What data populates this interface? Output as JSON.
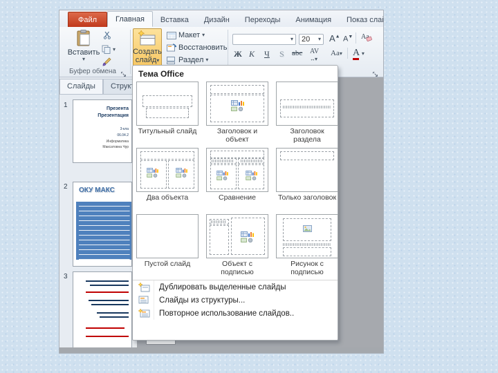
{
  "icons": {
    "dropdown_arrow": "▾"
  },
  "ribbon": {
    "tabs": [
      {
        "label": "Файл"
      },
      {
        "label": "Главная"
      },
      {
        "label": "Вставка"
      },
      {
        "label": "Дизайн"
      },
      {
        "label": "Переходы"
      },
      {
        "label": "Анимация"
      },
      {
        "label": "Показ слайдов"
      }
    ],
    "clipboard_group": {
      "paste": "Вставить",
      "label": "Буфер обмена"
    },
    "slides_group": {
      "new_slide_line1": "Создать",
      "new_slide_line2": "слайд",
      "layout": "Макет",
      "reset": "Восстановить",
      "section": "Раздел"
    },
    "font_group": {
      "font_size": "20",
      "bold": "Ж",
      "italic": "К",
      "underline": "Ч",
      "shadow": "S",
      "strike": "abc",
      "spacing": "AV",
      "case": "Aa",
      "color": "A",
      "grow": "A",
      "shrink": "A"
    }
  },
  "slides_panel": {
    "tab_slides": "Слайды",
    "tab_outline": "Структура",
    "slides": [
      {
        "number": "1",
        "title_line1": "Презента",
        "title_line2": "Презентация",
        "meta": [
          "3-кла",
          "06.04.2",
          "Информатика",
          "Максатовна Чур"
        ]
      },
      {
        "number": "2",
        "title": "ОКУ МАКС"
      },
      {
        "number": "3"
      }
    ]
  },
  "dropdown": {
    "header": "Тема Office",
    "layouts": [
      {
        "label": "Титульный слайд"
      },
      {
        "label": "Заголовок и объект"
      },
      {
        "label": "Заголовок раздела"
      },
      {
        "label": "Два объекта"
      },
      {
        "label": "Сравнение"
      },
      {
        "label": "Только заголовок"
      },
      {
        "label": "Пустой слайд"
      },
      {
        "label": "Объект с подписью"
      },
      {
        "label": "Рисунок с подписью"
      }
    ],
    "menu_items": [
      {
        "label": "Дублировать выделенные слайды"
      },
      {
        "label": "Слайды из структуры..."
      },
      {
        "label": "Повторное использование слайдов.."
      }
    ]
  },
  "colors": {
    "file_tab": "#c0391c",
    "new_slide_highlight": "#f6c35a",
    "slide_title_blue": "#17375e",
    "content_box_blue": "#4f81bd"
  }
}
